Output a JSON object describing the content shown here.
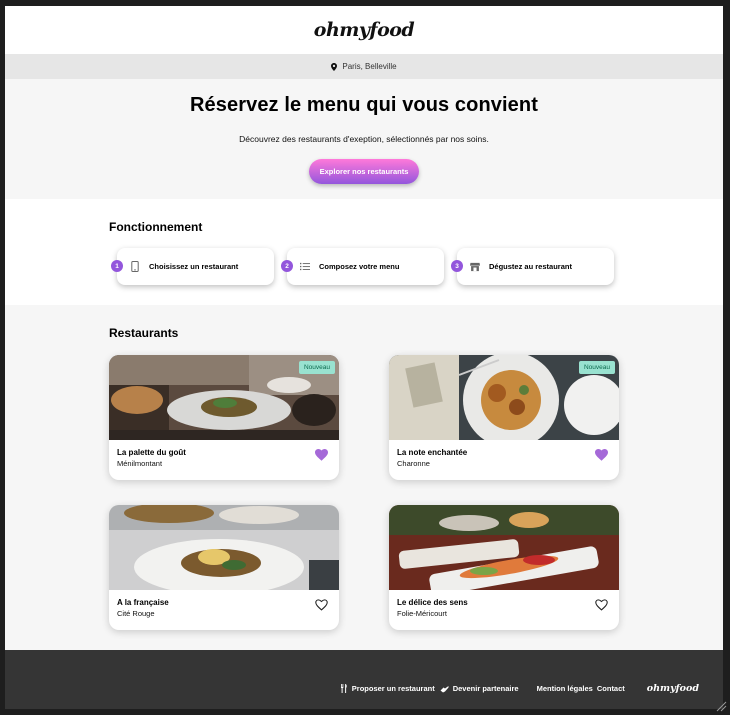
{
  "header": {
    "logo": "ohmyfood"
  },
  "location": {
    "icon": "map-pin-icon",
    "label": "Paris, Belleville"
  },
  "hero": {
    "title": "Réservez le menu qui vous convient",
    "subtitle": "Découvrez des restaurants d'exeption, sélectionnés par nos soins.",
    "cta_label": "Explorer nos restaurants"
  },
  "how": {
    "title": "Fonctionnement",
    "steps": [
      {
        "num": "1",
        "icon": "phone-icon",
        "label": "Choisissez un restaurant"
      },
      {
        "num": "2",
        "icon": "list-icon",
        "label": "Composez votre menu"
      },
      {
        "num": "3",
        "icon": "store-icon",
        "label": "Dégustez au restaurant"
      }
    ]
  },
  "restaurants": {
    "title": "Restaurants",
    "items": [
      {
        "name": "La palette du goût",
        "area": "Ménilmontant",
        "badge": "Nouveau",
        "liked": true
      },
      {
        "name": "La note enchantée",
        "area": "Charonne",
        "badge": "Nouveau",
        "liked": true
      },
      {
        "name": "A la française",
        "area": "Cité Rouge",
        "badge": "",
        "liked": false
      },
      {
        "name": "Le délice des sens",
        "area": "Folie-Méricourt",
        "badge": "",
        "liked": false
      }
    ]
  },
  "footer": {
    "propose": "Proposer un restaurant",
    "partner": "Devenir partenaire",
    "legal": "Mention légales",
    "contact": "Contact",
    "logo": "ohmyfood"
  },
  "colors": {
    "accent": "#9356dc",
    "accent_light": "#ff79da",
    "badge_bg": "#99e2d0",
    "footer_bg": "#353535"
  }
}
